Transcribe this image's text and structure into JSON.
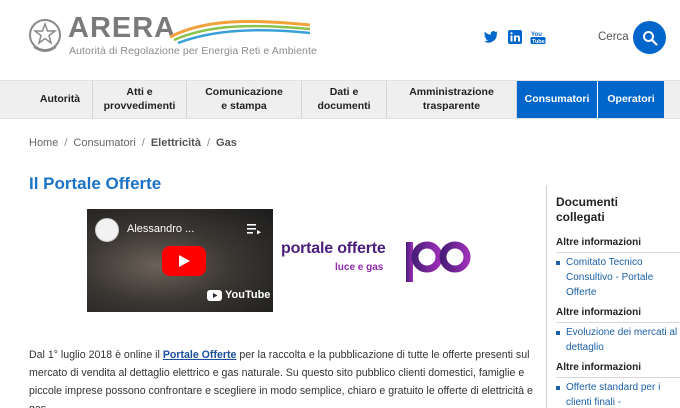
{
  "header": {
    "logo_name": "ARERA",
    "logo_subtitle": "Autorità di Regolazione per Energia Reti e Ambiente",
    "social": [
      "twitter-icon",
      "linkedin-icon",
      "youtube-icon"
    ],
    "search_label": "Cerca",
    "brand_color": "#0066cc"
  },
  "nav": {
    "items": [
      {
        "label": "Autorità"
      },
      {
        "label": "Atti e provvedimenti"
      },
      {
        "label": "Comunicazione e stampa"
      },
      {
        "label": "Dati e documenti"
      },
      {
        "label": "Amministrazione trasparente"
      },
      {
        "label": "Consumatori",
        "active": true
      },
      {
        "label": "Operatori",
        "active": true
      }
    ]
  },
  "breadcrumb": {
    "items": [
      "Home",
      "Consumatori",
      "Elettricità",
      "Gas"
    ],
    "separator": "/"
  },
  "main": {
    "title": "Il Portale Offerte",
    "video": {
      "title": "Alessandro ...",
      "platform": "YouTube"
    },
    "portal_logo": {
      "line1": "portale offerte",
      "line2": "luce e gas",
      "mark": "PO"
    },
    "intro": {
      "before_link": "Dal 1° luglio 2018 è online il ",
      "link": "Portale Offerte",
      "after_link": " per la raccolta e la pubblicazione di tutte le offerte presenti sul mercato di vendita al dettaglio elettrico e gas naturale. Su questo sito pubblico  clienti domestici, famiglie e piccole imprese possono confrontare e scegliere in modo semplice, chiaro e gratuito le offerte di elettricità e gas."
    }
  },
  "sidebar": {
    "title": "Documenti collegati",
    "sections": [
      {
        "heading": "Altre informazioni",
        "link": "Comitato Tecnico Consultivo - Portale Offerte"
      },
      {
        "heading": "Altre informazioni",
        "link": "Evoluzione dei mercati al dettaglio"
      },
      {
        "heading": "Altre informazioni",
        "link": "Offerte standard per i clienti finali -"
      }
    ]
  }
}
